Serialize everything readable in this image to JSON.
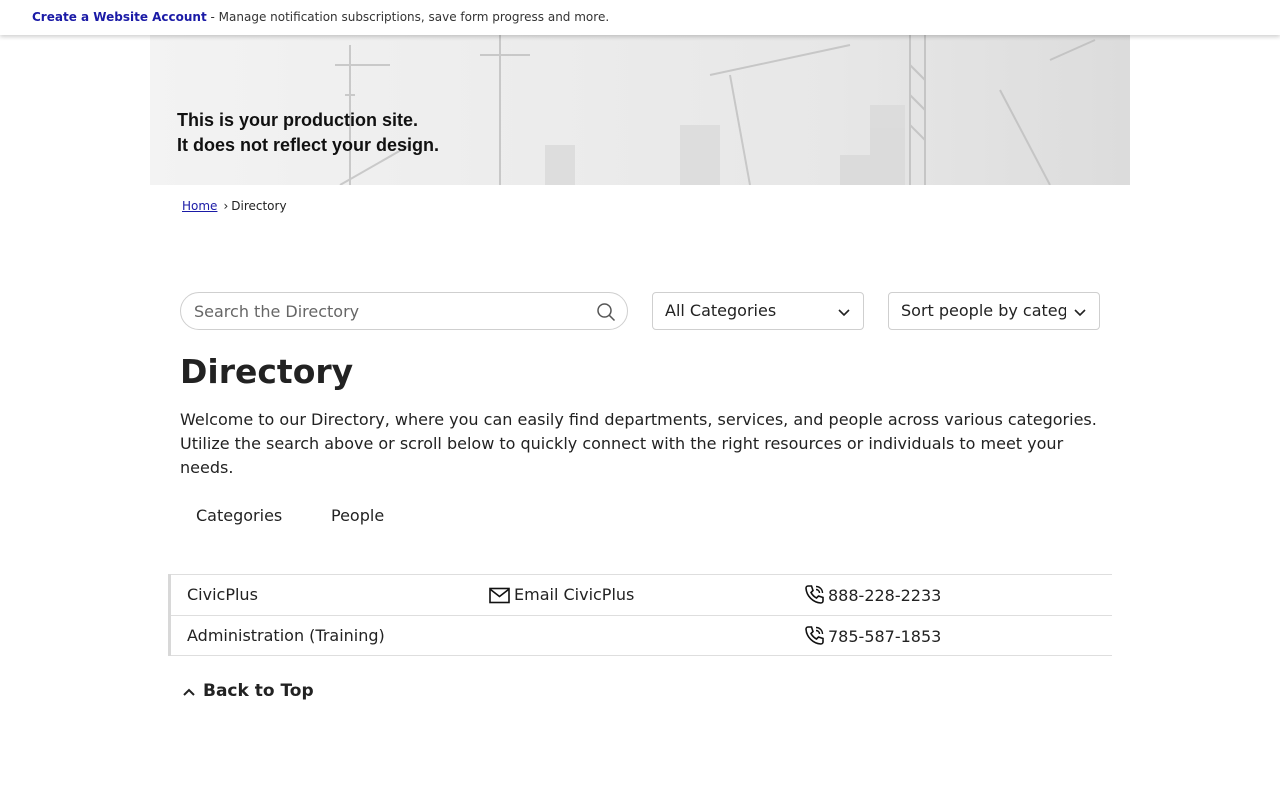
{
  "topbar": {
    "link_label": "Create a Website Account",
    "message": " - Manage notification subscriptions, save form progress and more."
  },
  "banner": {
    "line1": "This is your production site.",
    "line2": "It does not reflect your design."
  },
  "breadcrumb": {
    "home": "Home",
    "separator": "›",
    "current": "Directory"
  },
  "search": {
    "placeholder": "Search the Directory",
    "icon": "search-icon"
  },
  "filters": {
    "category_selected": "All Categories",
    "sort_selected": "Sort people by category"
  },
  "page": {
    "title": "Directory",
    "description": "Welcome to our Directory, where you can easily find departments, services, and people across various categories. Utilize the search above or scroll below to quickly connect with the right resources or individuals to meet your needs."
  },
  "tabs": [
    {
      "label": "Categories"
    },
    {
      "label": "People"
    }
  ],
  "directory": [
    {
      "name": "CivicPlus",
      "email_label": "Email CivicPlus",
      "phone": "888-228-2233"
    },
    {
      "name": "Administration (Training)",
      "email_label": "",
      "phone": "785-587-1853"
    }
  ],
  "back_to_top": "Back to Top",
  "colors": {
    "link": "#1a1aa6",
    "text": "#222222",
    "border": "#cfcfcf"
  }
}
